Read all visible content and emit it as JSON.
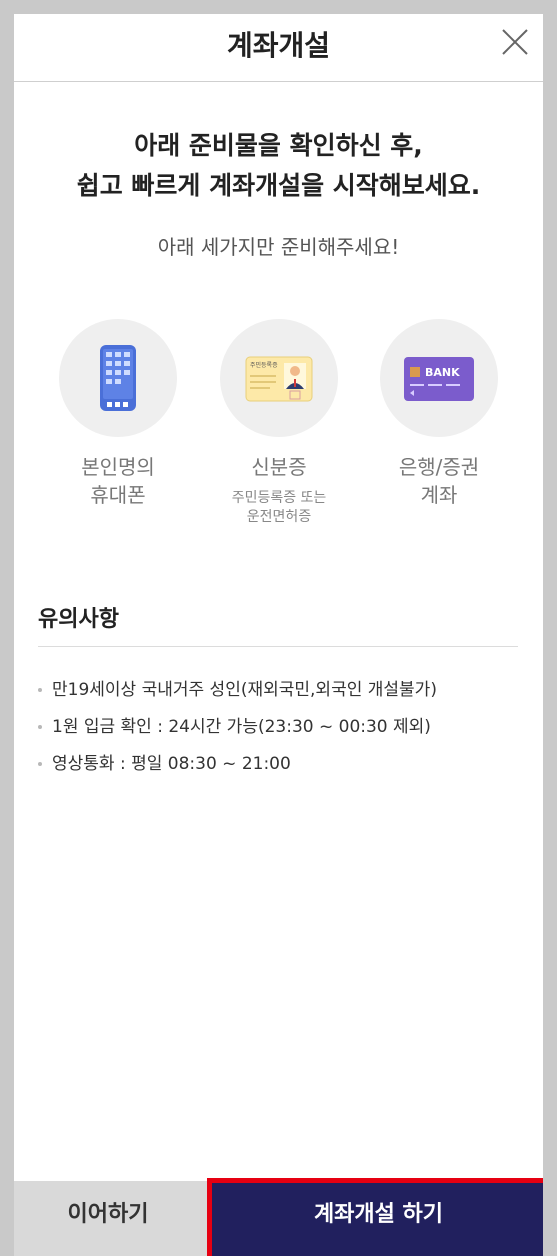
{
  "header": {
    "title": "계좌개설",
    "close_icon": "close-icon"
  },
  "intro": {
    "headline_line1": "아래 준비물을 확인하신 후,",
    "headline_line2": "쉽고 빠르게 계좌개설을 시작해보세요.",
    "subtitle": "아래 세가지만 준비해주세요!"
  },
  "requirements": [
    {
      "icon": "smartphone-icon",
      "label_line1": "본인명의",
      "label_line2": "휴대폰",
      "note_line1": "",
      "note_line2": ""
    },
    {
      "icon": "id-card-icon",
      "card_text": "주민등록증",
      "label_line1": "신분증",
      "label_line2": "",
      "note_line1": "주민등록증 또는",
      "note_line2": "운전면허증"
    },
    {
      "icon": "bank-card-icon",
      "card_text": "BANK",
      "label_line1": "은행/증권",
      "label_line2": "계좌",
      "note_line1": "",
      "note_line2": ""
    }
  ],
  "notice": {
    "title": "유의사항",
    "items": [
      "만19세이상 국내거주 성인(재외국민,외국인 개설불가)",
      "1원 입금 확인 : 24시간 가능(23:30 ~ 00:30 제외)",
      "영상통화 : 평일 08:30 ~ 21:00"
    ]
  },
  "footer": {
    "continue_label": "이어하기",
    "open_label": "계좌개설 하기"
  },
  "colors": {
    "primary": "#21205e",
    "highlight": "#e60012",
    "phone": "#4a6fd8",
    "bank_card": "#7b5ccc",
    "id_card": "#fde9a8"
  }
}
